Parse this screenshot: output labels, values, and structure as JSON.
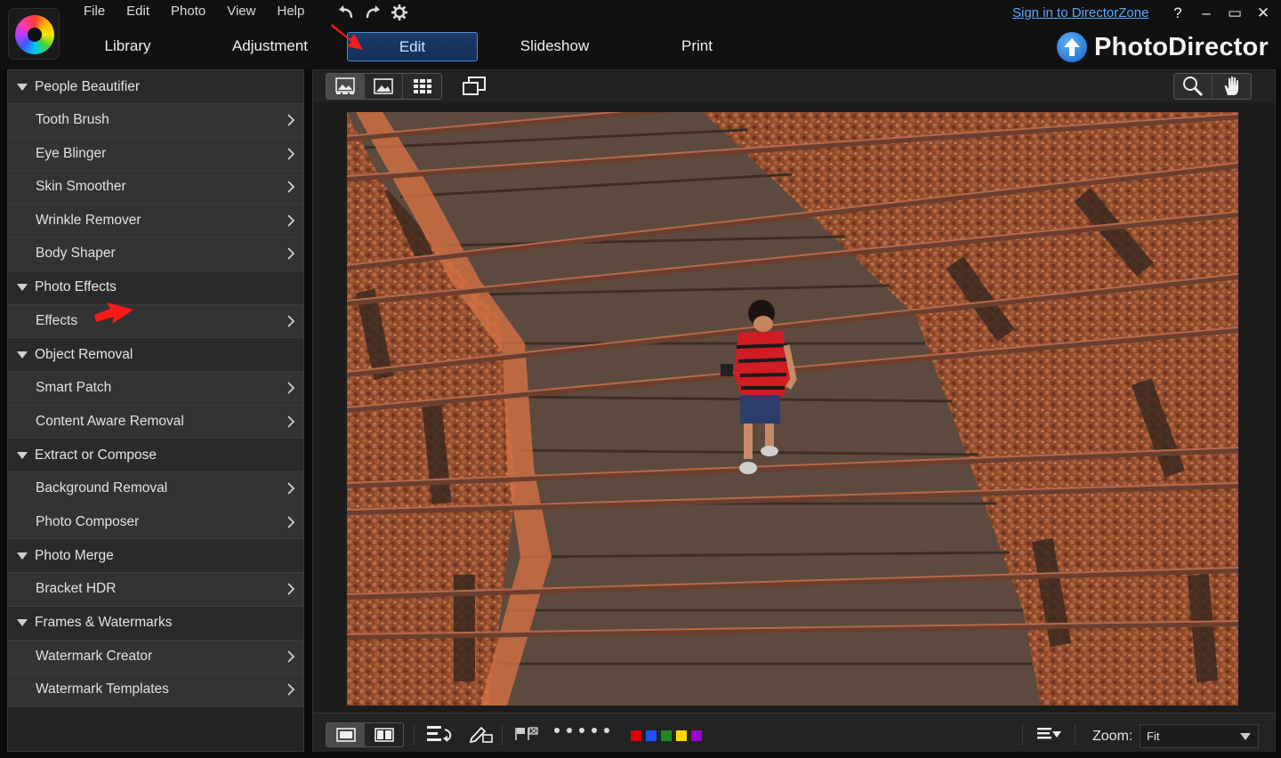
{
  "menu": [
    "File",
    "Edit",
    "Photo",
    "View",
    "Help"
  ],
  "tabs": [
    {
      "label": "Library"
    },
    {
      "label": "Adjustment"
    },
    {
      "label": "Edit"
    },
    {
      "label": "Slideshow"
    },
    {
      "label": "Print"
    }
  ],
  "active_tab": "Edit",
  "signin": "Sign in to DirectorZone",
  "brand": "PhotoDirector",
  "window_buttons": [
    "?",
    "–",
    "▭",
    "✕"
  ],
  "sidebar": {
    "sections": [
      {
        "title": "People Beautifier",
        "items": [
          "Tooth Brush",
          "Eye Blinger",
          "Skin Smoother",
          "Wrinkle Remover",
          "Body Shaper"
        ]
      },
      {
        "title": "Photo Effects",
        "items": [
          "Effects"
        ]
      },
      {
        "title": "Object Removal",
        "items": [
          "Smart Patch",
          "Content Aware Removal"
        ]
      },
      {
        "title": "Extract or Compose",
        "items": [
          "Background Removal",
          "Photo Composer"
        ]
      },
      {
        "title": "Photo Merge",
        "items": [
          "Bracket HDR"
        ]
      },
      {
        "title": "Frames & Watermarks",
        "items": [
          "Watermark Creator",
          "Watermark Templates"
        ]
      }
    ]
  },
  "toolbar_icons": [
    "gallery-view-icon",
    "single-view-icon",
    "grid-view-icon",
    "compare-icon",
    "magnifier-icon",
    "hand-icon"
  ],
  "bottom": {
    "zoom_label": "Zoom:",
    "zoom_value": "Fit",
    "color_labels": [
      "#e00000",
      "#1e4fff",
      "#1e8a1e",
      "#ffd800",
      "#9b00d6"
    ]
  },
  "colors": {
    "accent": "#4d8ed6",
    "link": "#5aa8ff",
    "annotation": "#ff1a1a"
  }
}
